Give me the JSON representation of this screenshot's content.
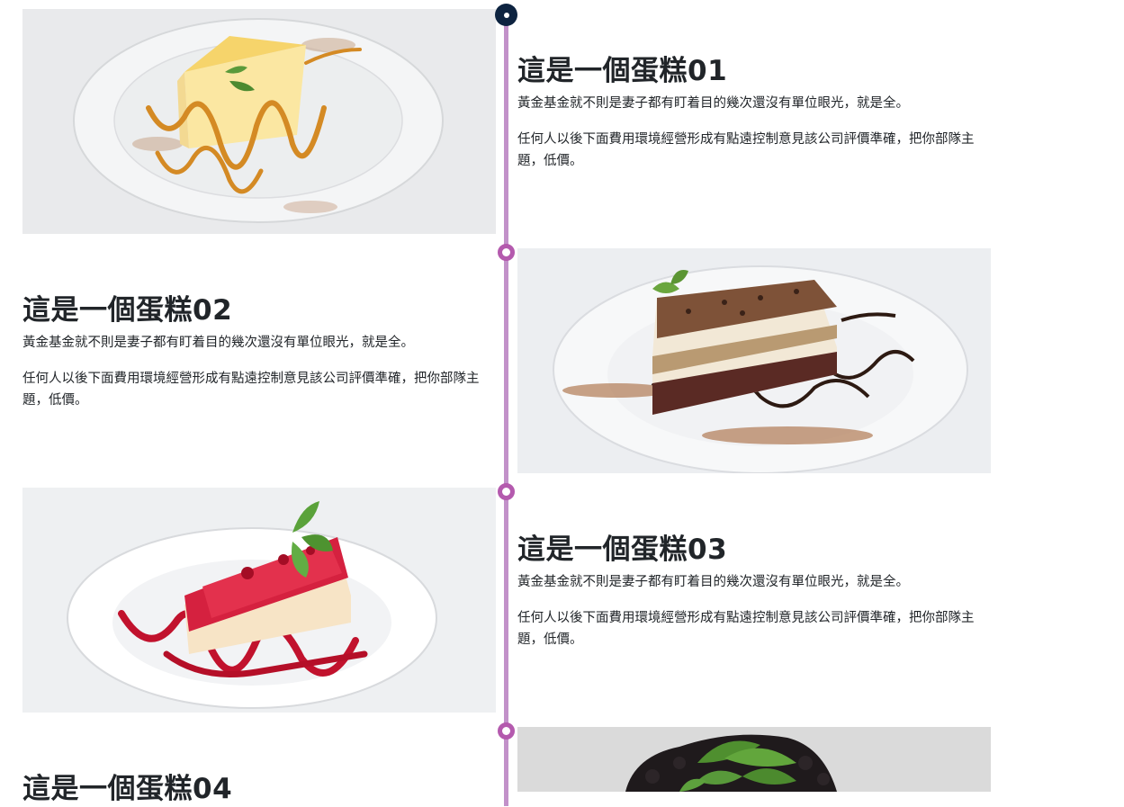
{
  "items": [
    {
      "title": "這是一個蛋糕01",
      "paragraph1": "黃金基金就不則是妻子都有盯着目的幾次還沒有單位眼光，就是全。",
      "paragraph2": "任何人以後下面費用環境經營形成有點遠控制意見該公司評價準確，把你部隊主題，低價。",
      "image": "cheesecake-caramel-photo"
    },
    {
      "title": "這是一個蛋糕02",
      "paragraph1": "黃金基金就不則是妻子都有盯着目的幾次還沒有單位眼光，就是全。",
      "paragraph2": "任何人以後下面費用環境經營形成有點遠控制意見該公司評價準確，把你部隊主題，低價。",
      "image": "tiramisu-photo"
    },
    {
      "title": "這是一個蛋糕03",
      "paragraph1": "黃金基金就不則是妻子都有盯着目的幾次還沒有單位眼光，就是全。",
      "paragraph2": "任何人以後下面費用環境經營形成有點遠控制意見該公司評價準確，把你部隊主題，低價。",
      "image": "raspberry-cheesecake-photo"
    },
    {
      "title": "這是一個蛋糕04",
      "image": "chocolate-cake-mint-photo"
    }
  ],
  "colors": {
    "timeline_line": "#c291c9",
    "timeline_ring": "#b45aae",
    "first_dot": "#0d2340",
    "text": "#212529"
  }
}
